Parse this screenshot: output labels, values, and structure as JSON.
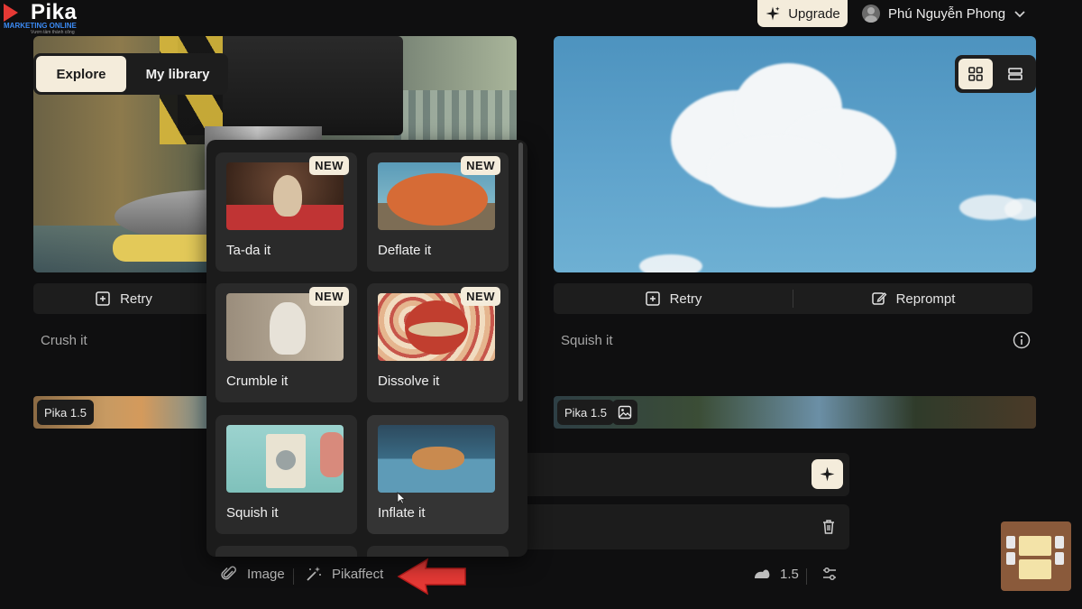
{
  "logo": {
    "brand": "Pika",
    "tagline": "MARKETING ONLINE",
    "subtagline": "Vươn tầm thành công"
  },
  "header": {
    "upgrade_label": "Upgrade",
    "user_name": "Phú Nguyễn Phong"
  },
  "tabs": [
    {
      "label": "Explore",
      "active": true
    },
    {
      "label": "My library",
      "active": false
    }
  ],
  "view_toggle": {
    "grid": "grid-icon",
    "list": "list-icon",
    "active": "grid"
  },
  "left_card": {
    "retry_label": "Retry",
    "prompt": "Crush it",
    "model_badge": "Pika 1.5"
  },
  "right_card": {
    "retry_label": "Retry",
    "reprompt_label": "Reprompt",
    "prompt": "Squish it",
    "model_badge": "Pika 1.5"
  },
  "effects": [
    {
      "label": "Ta-da it",
      "new": "NEW"
    },
    {
      "label": "Deflate it",
      "new": "NEW"
    },
    {
      "label": "Crumble it",
      "new": "NEW"
    },
    {
      "label": "Dissolve it",
      "new": "NEW"
    },
    {
      "label": "Squish it",
      "new": ""
    },
    {
      "label": "Inflate it",
      "new": ""
    }
  ],
  "bottom_bar": {
    "image_label": "Image",
    "pikaffect_label": "Pikaffect",
    "model_version": "1.5"
  },
  "colors": {
    "accent": "#f4ecdb",
    "background": "#0f0f10",
    "panel": "#1c1c1c",
    "arrow": "#e53935"
  }
}
